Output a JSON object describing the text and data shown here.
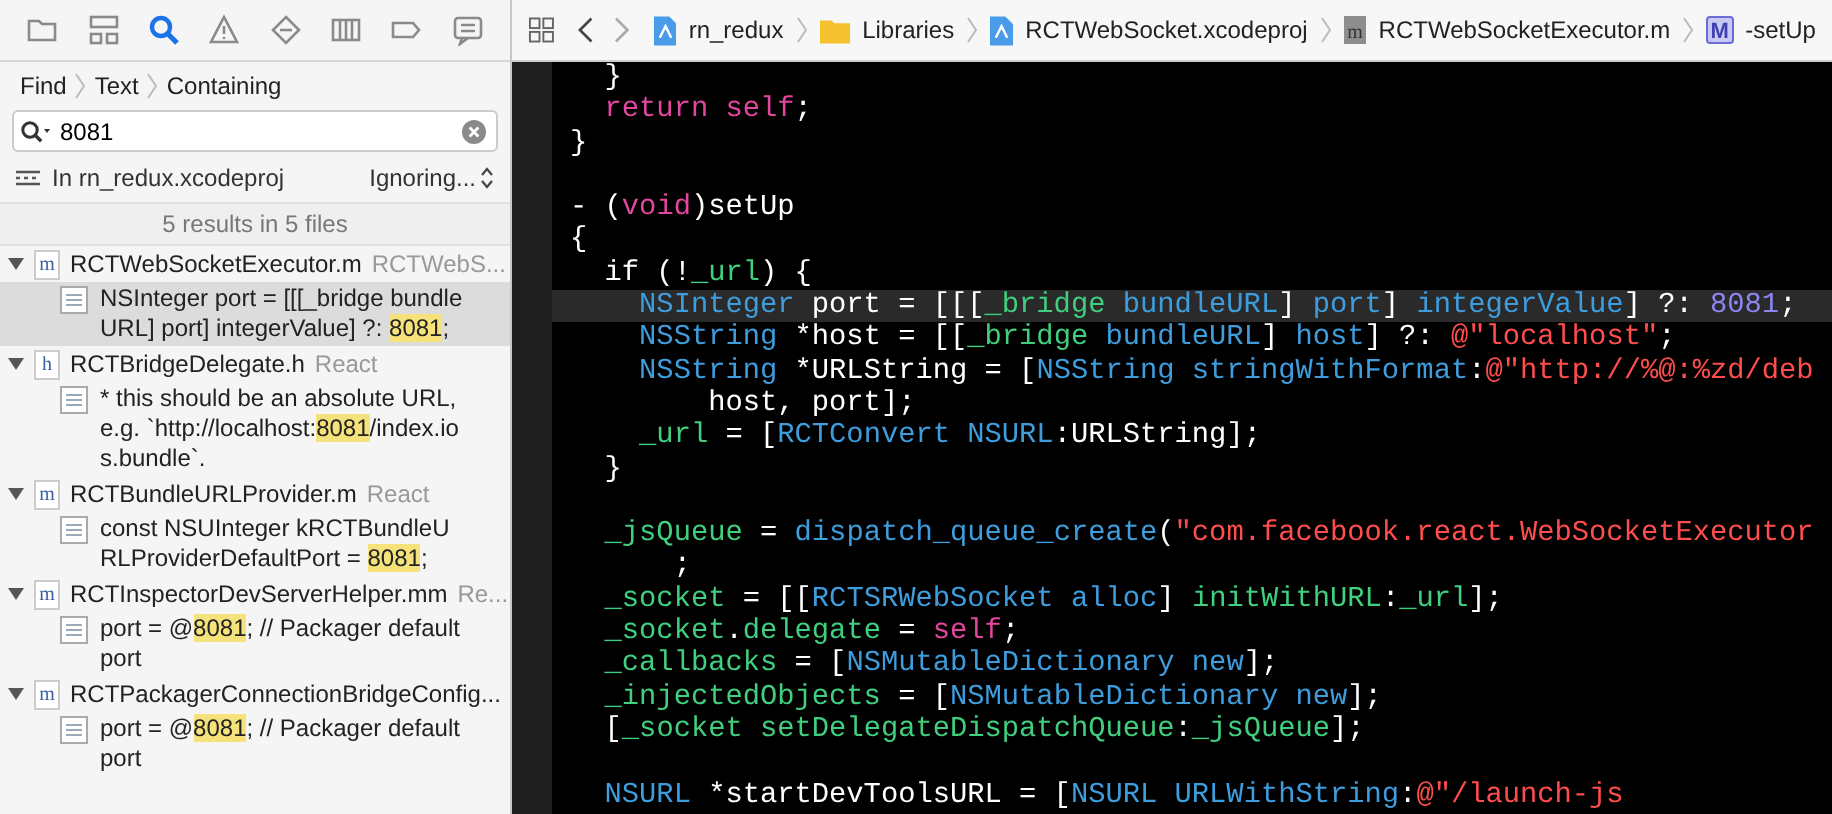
{
  "navigator_tabs": [
    {
      "kind": "folder",
      "selected": false
    },
    {
      "kind": "hierarchy",
      "selected": false
    },
    {
      "kind": "search",
      "selected": true
    },
    {
      "kind": "warning",
      "selected": false
    },
    {
      "kind": "diamond",
      "selected": false
    },
    {
      "kind": "bars",
      "selected": false
    },
    {
      "kind": "tag",
      "selected": false
    },
    {
      "kind": "report",
      "selected": false
    }
  ],
  "find_path": [
    "Find",
    "Text",
    "Containing"
  ],
  "search": {
    "value": "8081"
  },
  "scope": {
    "label": "In rn_redux.xcodeproj",
    "option": "Ignoring..."
  },
  "summary": "5 results in 5 files",
  "results": [
    {
      "icon_letter": "m",
      "name": "RCTWebSocketExecutor.m",
      "group": "RCTWebS...",
      "expanded": true,
      "children": [
        {
          "before": "NSInteger port = [[[_bridge bundleURL] port] integerValue] ?: ",
          "match": "8081",
          "after": ";",
          "selected": true
        }
      ]
    },
    {
      "icon_letter": "h",
      "name": "RCTBridgeDelegate.h",
      "group": "React",
      "expanded": true,
      "children": [
        {
          "before": "* this should be an absolute URL, e.g. `http://localhost:",
          "match": "8081",
          "after": "/index.ios.bundle`.",
          "selected": false
        }
      ]
    },
    {
      "icon_letter": "m",
      "name": "RCTBundleURLProvider.m",
      "group": "React",
      "expanded": true,
      "children": [
        {
          "before": "const NSUInteger kRCTBundleURLProviderDefaultPort = ",
          "match": "8081",
          "after": ";",
          "selected": false
        }
      ]
    },
    {
      "icon_letter": "m",
      "name": "RCTInspectorDevServerHelper.mm",
      "group": "Re...",
      "expanded": true,
      "children": [
        {
          "before": "port = @",
          "match": "8081",
          "after": "; // Packager default port",
          "selected": false
        }
      ]
    },
    {
      "icon_letter": "m",
      "name": "RCTPackagerConnectionBridgeConfig...",
      "expanded": true,
      "children": [
        {
          "before": "port = @",
          "match": "8081",
          "after": "; // Packager default port",
          "selected": false
        }
      ]
    }
  ],
  "jump_bar": [
    {
      "kind": "project",
      "label": "rn_redux"
    },
    {
      "kind": "folder",
      "label": "Libraries"
    },
    {
      "kind": "project",
      "label": "RCTWebSocket.xcodeproj"
    },
    {
      "kind": "file",
      "label": "RCTWebSocketExecutor.m",
      "icon_letter": "m"
    },
    {
      "kind": "method",
      "label": "-setUp",
      "icon_letter": "M"
    }
  ],
  "code": [
    {
      "kind": "code",
      "tokens": [
        {
          "t": "  }",
          "kind": "plain"
        }
      ]
    },
    {
      "kind": "code",
      "tokens": [
        {
          "t": "  return",
          "kind": "keyword"
        },
        {
          "t": " self",
          "kind": "keyword"
        },
        {
          "t": ";",
          "kind": "plain"
        }
      ]
    },
    {
      "kind": "code",
      "tokens": [
        {
          "t": "}",
          "kind": "plain"
        }
      ]
    },
    {
      "kind": "blank"
    },
    {
      "kind": "code",
      "tokens": [
        {
          "t": "- (",
          "kind": "plain"
        },
        {
          "t": "void",
          "kind": "keyword"
        },
        {
          "t": ")setUp",
          "kind": "plain"
        }
      ]
    },
    {
      "kind": "code",
      "tokens": [
        {
          "t": "{",
          "kind": "plain"
        }
      ]
    },
    {
      "kind": "code",
      "tokens": [
        {
          "t": "  if (!",
          "kind": "plain"
        },
        {
          "t": "_url",
          "kind": "ivar"
        },
        {
          "t": ") {",
          "kind": "plain"
        }
      ]
    },
    {
      "kind": "code",
      "current": true,
      "tokens": [
        {
          "t": "    NSInteger",
          "kind": "type"
        },
        {
          "t": " port = [[[",
          "kind": "plain"
        },
        {
          "t": "_bridge",
          "kind": "ivar"
        },
        {
          "t": " bundleURL",
          "kind": "type"
        },
        {
          "t": "] ",
          "kind": "plain"
        },
        {
          "t": "port",
          "kind": "type"
        },
        {
          "t": "] ",
          "kind": "plain"
        },
        {
          "t": "integerValue",
          "kind": "type"
        },
        {
          "t": "] ?: ",
          "kind": "plain"
        },
        {
          "t": "8081",
          "kind": "number"
        },
        {
          "t": ";",
          "kind": "plain"
        }
      ]
    },
    {
      "kind": "code",
      "tokens": [
        {
          "t": "    NSString",
          "kind": "type"
        },
        {
          "t": " *host = [[",
          "kind": "plain"
        },
        {
          "t": "_bridge",
          "kind": "ivar"
        },
        {
          "t": " bundleURL",
          "kind": "type"
        },
        {
          "t": "] ",
          "kind": "plain"
        },
        {
          "t": "host",
          "kind": "type"
        },
        {
          "t": "] ?: ",
          "kind": "plain"
        },
        {
          "t": "@\"localhost\"",
          "kind": "string"
        },
        {
          "t": ";",
          "kind": "plain"
        }
      ]
    },
    {
      "kind": "code",
      "tokens": [
        {
          "t": "    NSString",
          "kind": "type"
        },
        {
          "t": " *URLString = [",
          "kind": "plain"
        },
        {
          "t": "NSString",
          "kind": "type"
        },
        {
          "t": " stringWithFormat",
          "kind": "type"
        },
        {
          "t": ":",
          "kind": "plain"
        },
        {
          "t": "@\"http://%@:%zd/deb",
          "kind": "string"
        }
      ]
    },
    {
      "kind": "code",
      "tokens": [
        {
          "t": "        host, port];",
          "kind": "plain"
        }
      ]
    },
    {
      "kind": "code",
      "tokens": [
        {
          "t": "    _url",
          "kind": "ivar"
        },
        {
          "t": " = [",
          "kind": "plain"
        },
        {
          "t": "RCTConvert",
          "kind": "type"
        },
        {
          "t": " NSURL",
          "kind": "type"
        },
        {
          "t": ":URLString];",
          "kind": "plain"
        }
      ]
    },
    {
      "kind": "code",
      "tokens": [
        {
          "t": "  }",
          "kind": "plain"
        }
      ]
    },
    {
      "kind": "blank"
    },
    {
      "kind": "code",
      "tokens": [
        {
          "t": "  _jsQueue",
          "kind": "ivar"
        },
        {
          "t": " = ",
          "kind": "plain"
        },
        {
          "t": "dispatch_queue_create",
          "kind": "type"
        },
        {
          "t": "(",
          "kind": "plain"
        },
        {
          "t": "\"com.facebook.react.WebSocketExecutor",
          "kind": "string"
        }
      ]
    },
    {
      "kind": "code",
      "tokens": [
        {
          "t": "      ;",
          "kind": "plain"
        }
      ]
    },
    {
      "kind": "code",
      "tokens": [
        {
          "t": "  _socket",
          "kind": "ivar"
        },
        {
          "t": " = [[",
          "kind": "plain"
        },
        {
          "t": "RCTSRWebSocket",
          "kind": "type"
        },
        {
          "t": " alloc",
          "kind": "type"
        },
        {
          "t": "] ",
          "kind": "plain"
        },
        {
          "t": "initWithURL",
          "kind": "ivar"
        },
        {
          "t": ":",
          "kind": "plain"
        },
        {
          "t": "_url",
          "kind": "ivar"
        },
        {
          "t": "];",
          "kind": "plain"
        }
      ]
    },
    {
      "kind": "code",
      "tokens": [
        {
          "t": "  _socket",
          "kind": "ivar"
        },
        {
          "t": ".",
          "kind": "plain"
        },
        {
          "t": "delegate",
          "kind": "ivar"
        },
        {
          "t": " = ",
          "kind": "plain"
        },
        {
          "t": "self",
          "kind": "keyword"
        },
        {
          "t": ";",
          "kind": "plain"
        }
      ]
    },
    {
      "kind": "code",
      "tokens": [
        {
          "t": "  _callbacks",
          "kind": "ivar"
        },
        {
          "t": " = [",
          "kind": "plain"
        },
        {
          "t": "NSMutableDictionary",
          "kind": "type"
        },
        {
          "t": " new",
          "kind": "type"
        },
        {
          "t": "];",
          "kind": "plain"
        }
      ]
    },
    {
      "kind": "code",
      "tokens": [
        {
          "t": "  _injectedObjects",
          "kind": "ivar"
        },
        {
          "t": " = [",
          "kind": "plain"
        },
        {
          "t": "NSMutableDictionary",
          "kind": "type"
        },
        {
          "t": " new",
          "kind": "type"
        },
        {
          "t": "];",
          "kind": "plain"
        }
      ]
    },
    {
      "kind": "code",
      "tokens": [
        {
          "t": "  [",
          "kind": "plain"
        },
        {
          "t": "_socket",
          "kind": "ivar"
        },
        {
          "t": " setDelegateDispatchQueue",
          "kind": "ivar"
        },
        {
          "t": ":",
          "kind": "plain"
        },
        {
          "t": "_jsQueue",
          "kind": "ivar"
        },
        {
          "t": "];",
          "kind": "plain"
        }
      ]
    },
    {
      "kind": "blank"
    },
    {
      "kind": "code",
      "tokens": [
        {
          "t": "  NSURL",
          "kind": "type"
        },
        {
          "t": " *startDevToolsURL = [",
          "kind": "plain"
        },
        {
          "t": "NSURL",
          "kind": "type"
        },
        {
          "t": " URLWithString",
          "kind": "type"
        },
        {
          "t": ":",
          "kind": "plain"
        },
        {
          "t": "@\"/launch-js",
          "kind": "string"
        }
      ]
    }
  ]
}
